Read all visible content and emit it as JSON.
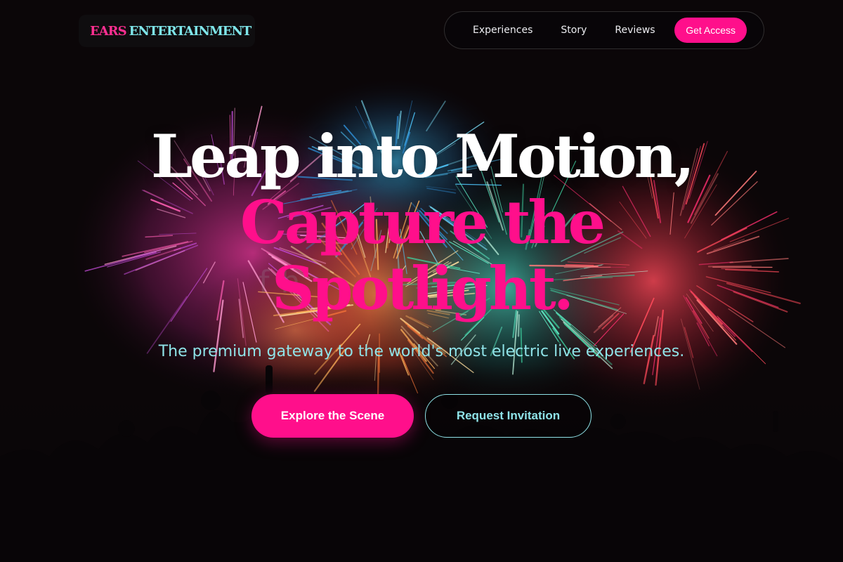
{
  "brand": {
    "name_part1": "EARS",
    "name_part2": "ENTERTAINMENT",
    "accent_pink": "#ff0f8b",
    "accent_cyan": "#8fe3e8"
  },
  "nav": {
    "links": [
      "Experiences",
      "Story",
      "Reviews"
    ],
    "cta_label": "Get Access"
  },
  "hero": {
    "headline_line1": "Leap into Motion,",
    "headline_line2": "Capture the Spotlight.",
    "faded_text": "f  h",
    "subtitle": "The premium gateway to the world's most electric live experiences.",
    "primary_button": "Explore the Scene",
    "secondary_button": "Request Invitation",
    "background_image": "fireworks-crowd-silhouette"
  }
}
